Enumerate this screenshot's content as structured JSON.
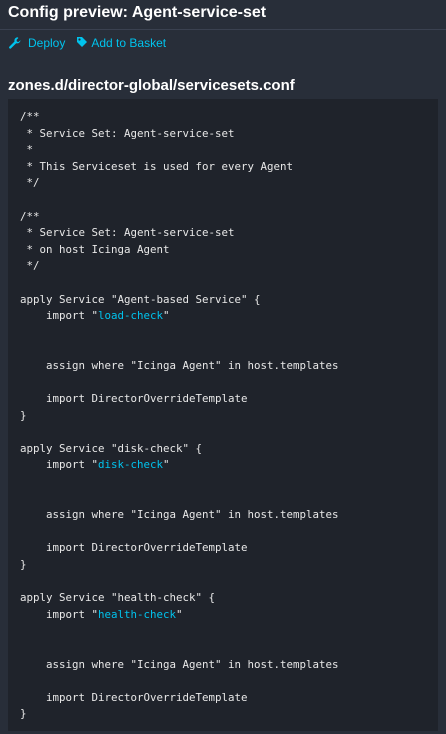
{
  "header": {
    "title": "Config preview: Agent-service-set"
  },
  "actions": {
    "deploy_label": "Deploy",
    "deploy_icon": "wrench-icon",
    "basket_label": "Add to Basket",
    "basket_icon": "tag-icon"
  },
  "file": {
    "path": "zones.d/director-global/servicesets.conf"
  },
  "colors": {
    "background": "#282e39",
    "code_background": "#1f232b",
    "accent": "#00c3ed",
    "text": "#ffffff"
  },
  "code": {
    "block1": "/**\n * Service Set: Agent-service-set\n *\n * This Serviceset is used for every Agent\n */\n\n/**\n * Service Set: Agent-service-set\n * on host Icinga Agent\n */\n\napply Service \"Agent-based Service\" {\n    import \"",
    "import1": "load-check",
    "block2": "\"\n\n\n    assign where \"Icinga Agent\" in host.templates\n\n    import DirectorOverrideTemplate\n}\n\napply Service \"disk-check\" {\n    import \"",
    "import2": "disk-check",
    "block3": "\"\n\n\n    assign where \"Icinga Agent\" in host.templates\n\n    import DirectorOverrideTemplate\n}\n\napply Service \"health-check\" {\n    import \"",
    "import3": "health-check",
    "block4": "\"\n\n\n    assign where \"Icinga Agent\" in host.templates\n\n    import DirectorOverrideTemplate\n}"
  }
}
